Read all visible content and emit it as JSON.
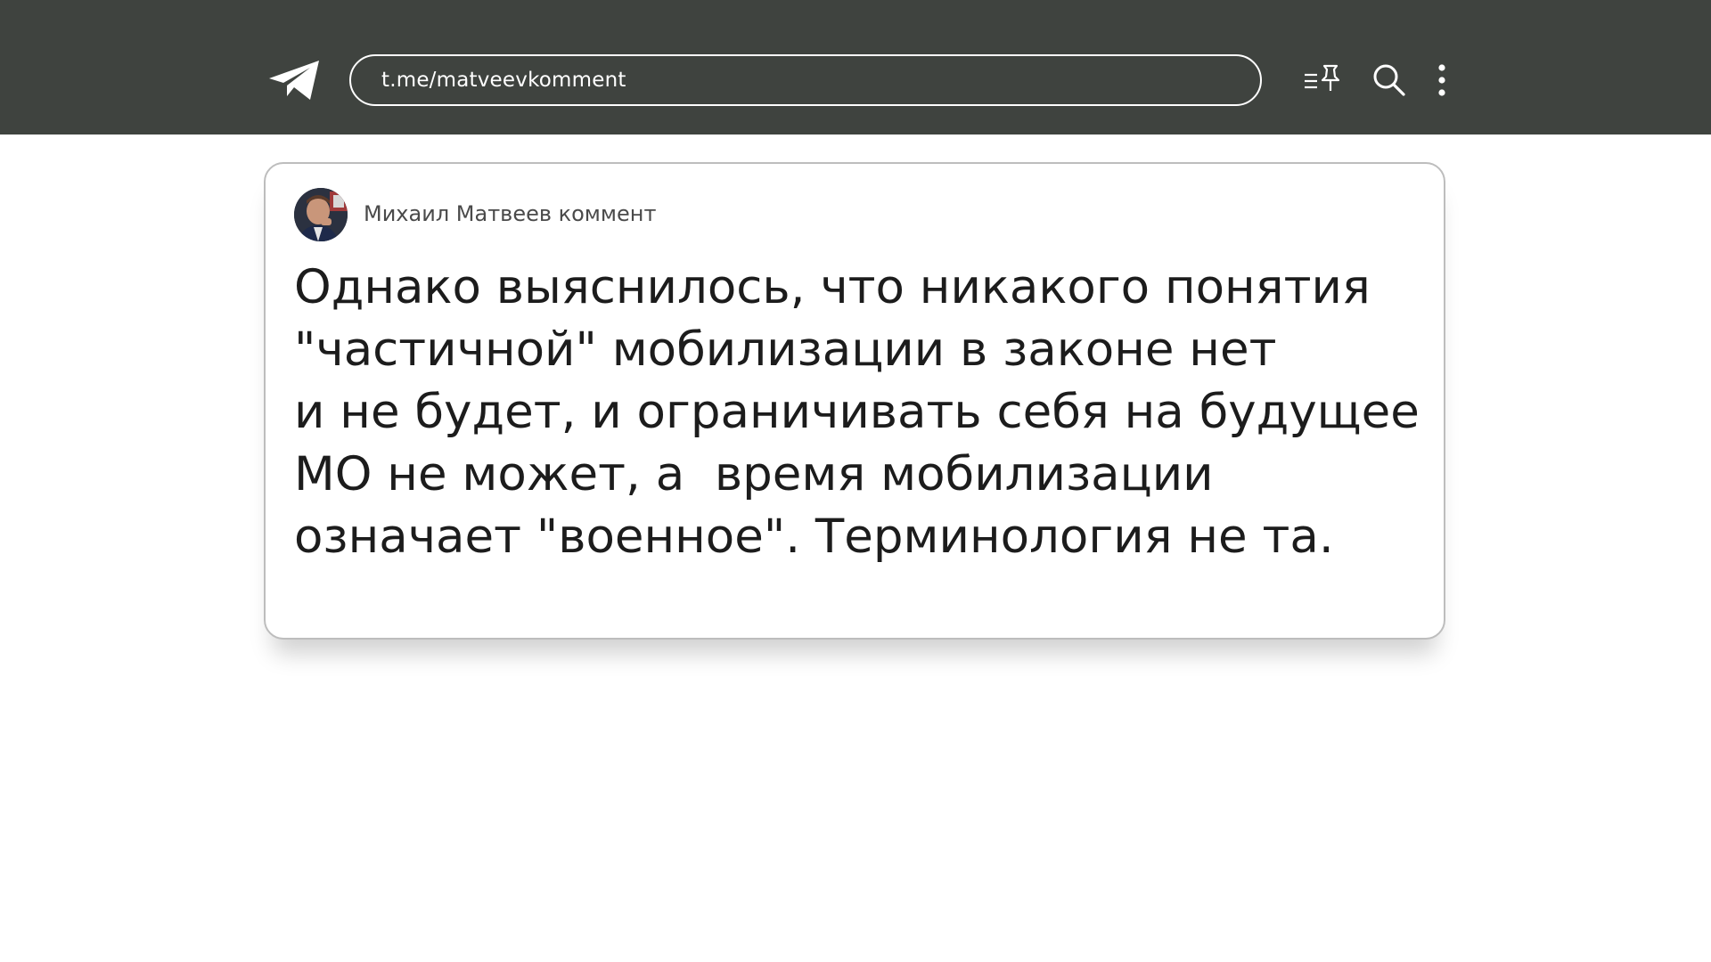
{
  "header": {
    "url": "t.me/matveevkomment",
    "icons": {
      "logo": "telegram-logo-icon",
      "pinned": "pinned-messages-icon",
      "search": "search-icon",
      "more": "more-vertical-icon"
    },
    "background": "#3f433f"
  },
  "post": {
    "channel_name": "Михаил Матвеев коммент",
    "avatar": "channel-avatar",
    "text_lines": [
      "Однако выяснилось, что никакого понятия",
      "\"частичной\" мобилизации в законе нет",
      "и не будет, и ограничивать себя на будущее",
      "МО не может, а  время мобилизации",
      "означает \"военное\". Терминология не та."
    ]
  }
}
